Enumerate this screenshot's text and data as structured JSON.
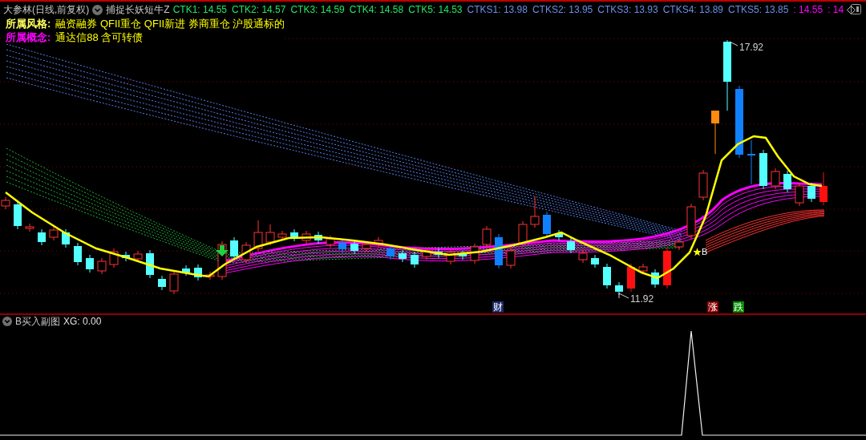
{
  "header": {
    "title": "大参林(日线,前复权)",
    "indicator": "捕捉长妖短牛Z",
    "readings": [
      {
        "label": "CTK1:",
        "value": "14.55",
        "color": "#20e860"
      },
      {
        "label": "CTK2:",
        "value": "14.57",
        "color": "#20e860"
      },
      {
        "label": "CTK3:",
        "value": "14.59",
        "color": "#20e860"
      },
      {
        "label": "CTK4:",
        "value": "14.58",
        "color": "#20e860"
      },
      {
        "label": "CTK5:",
        "value": "14.53",
        "color": "#20e860"
      },
      {
        "label": "CTKS1:",
        "value": "13.98",
        "color": "#6a8ee8"
      },
      {
        "label": "CTKS2:",
        "value": "13.95",
        "color": "#6a8ee8"
      },
      {
        "label": "CTKS3:",
        "value": "13.93",
        "color": "#6a8ee8"
      },
      {
        "label": "CTKS4:",
        "value": "13.89",
        "color": "#6a8ee8"
      },
      {
        "label": "CTKS5:",
        "value": "13.85",
        "color": "#6a8ee8"
      },
      {
        "label": ":",
        "value": "14.55",
        "color": "#ff00ff"
      },
      {
        "label": ":",
        "value": "14",
        "color": "#ff00ff"
      }
    ]
  },
  "info": [
    {
      "label": "所属风格:",
      "value": "融资融券 QFII重仓 QFII新进 券商重仓 沪股通标的",
      "color": "#ffff60"
    },
    {
      "label": "所属概念:",
      "value": "通达信88 含可转债",
      "color": "#ff00ff"
    }
  ],
  "chart_labels": {
    "high": "17.92",
    "low": "11.92",
    "signal": "B"
  },
  "event_tags": [
    {
      "text": "财",
      "color": "#1a2a6a"
    },
    {
      "text": "涨",
      "color": "#8a0000"
    },
    {
      "text": "跌",
      "color": "#008a00"
    }
  ],
  "subchart": {
    "title": "B买入副图",
    "reading": "XG: 0.00"
  }
}
